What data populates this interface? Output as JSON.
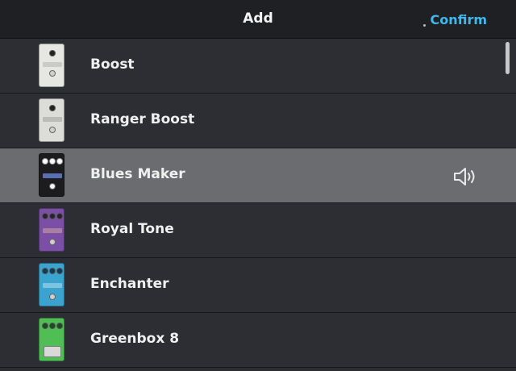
{
  "header": {
    "title": "Add",
    "confirm_label": "Confirm"
  },
  "colors": {
    "accent": "#3fb8ef",
    "selected_row": "#6b6c70"
  },
  "effects": [
    {
      "label": "Boost",
      "icon": "boost-pedal-icon",
      "pedal_color": "#e6e6e3",
      "selected": false
    },
    {
      "label": "Ranger Boost",
      "icon": "ranger-boost-pedal-icon",
      "pedal_color": "#dcdcd8",
      "selected": false
    },
    {
      "label": "Blues Maker",
      "icon": "blues-maker-pedal-icon",
      "pedal_color": "#1c1c1e",
      "selected": true,
      "action_icon": "speaker-icon"
    },
    {
      "label": "Royal Tone",
      "icon": "royal-tone-pedal-icon",
      "pedal_color": "#7b4fa6",
      "selected": false
    },
    {
      "label": "Enchanter",
      "icon": "enchanter-pedal-icon",
      "pedal_color": "#3aa3cf",
      "selected": false
    },
    {
      "label": "Greenbox 8",
      "icon": "greenbox-8-pedal-icon",
      "pedal_color": "#4fbf55",
      "selected": false
    }
  ]
}
